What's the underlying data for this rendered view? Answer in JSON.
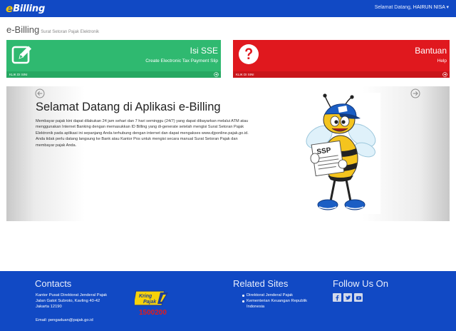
{
  "navbar": {
    "brand_e": "e",
    "brand_word": "Billing",
    "welcome_prefix": "Selamat Datang,",
    "user_name": "HAIRUN NISA",
    "caret": "▾"
  },
  "header": {
    "title": "e-Billing",
    "subtitle": "Surat Setoran Pajak Elektronik"
  },
  "tiles": [
    {
      "title": "Isi SSE",
      "desc": "Create Electronic Tax Payment Slip",
      "foot": "KLIK DI SINI",
      "color": "#2fb970",
      "icon": "edit-icon"
    },
    {
      "title": "Bantuan",
      "desc": "Help",
      "foot": "KLIK DI SINI",
      "color": "#e0181e",
      "icon": "question-icon"
    }
  ],
  "carousel": {
    "title": "Selamat Datang di Aplikasi e-Billing",
    "lines": [
      "Membayar pajak kini dapat dilakukan 24 jam sehari dan 7 hari seminggu (24/7) yang dapat dibayarkan melalui ATM atau",
      "menggunakan Internet Banking dengan memasukkan ID Billing yang di-generate setelah mengisi Surat Setoran Pajak",
      "Elektronik pada aplikasi ini sepanjang Anda terhubung dengan internet dan dapat mengakses www.djponline.pajak.go.id.",
      "Anda tidak perlu datang langsung ke Bank atau Kantor Pos untuk mengisi secara manual Surat Setoran Pajak dan",
      "membayar pajak Anda."
    ],
    "mascot_label": "SSP"
  },
  "footer": {
    "contacts_title": "Contacts",
    "address": [
      "Kantor Pusat Direktorat Jenderal Pajak",
      "Jalan Gatot Subroto, Kavling 40-42",
      "Jakarta 12190"
    ],
    "email_label": "Email:",
    "email": "pengaduan@pajak.go.id",
    "kring_top": "Kring",
    "kring_bottom": "Pajak",
    "kring_number": "1500200",
    "related_title": "Related Sites",
    "links": [
      {
        "line1": "Direktorat Jenderal Pajak",
        "line2": ""
      },
      {
        "line1": "Kementerian Keuangan Republik",
        "line2": "Indonesia"
      }
    ],
    "follow_title": "Follow Us On",
    "social": [
      "facebook-icon",
      "twitter-icon",
      "youtube-icon"
    ]
  },
  "colors": {
    "primary": "#1149c4",
    "green": "#2fb970",
    "red": "#e0181e",
    "brand_yellow": "#f7c600"
  }
}
